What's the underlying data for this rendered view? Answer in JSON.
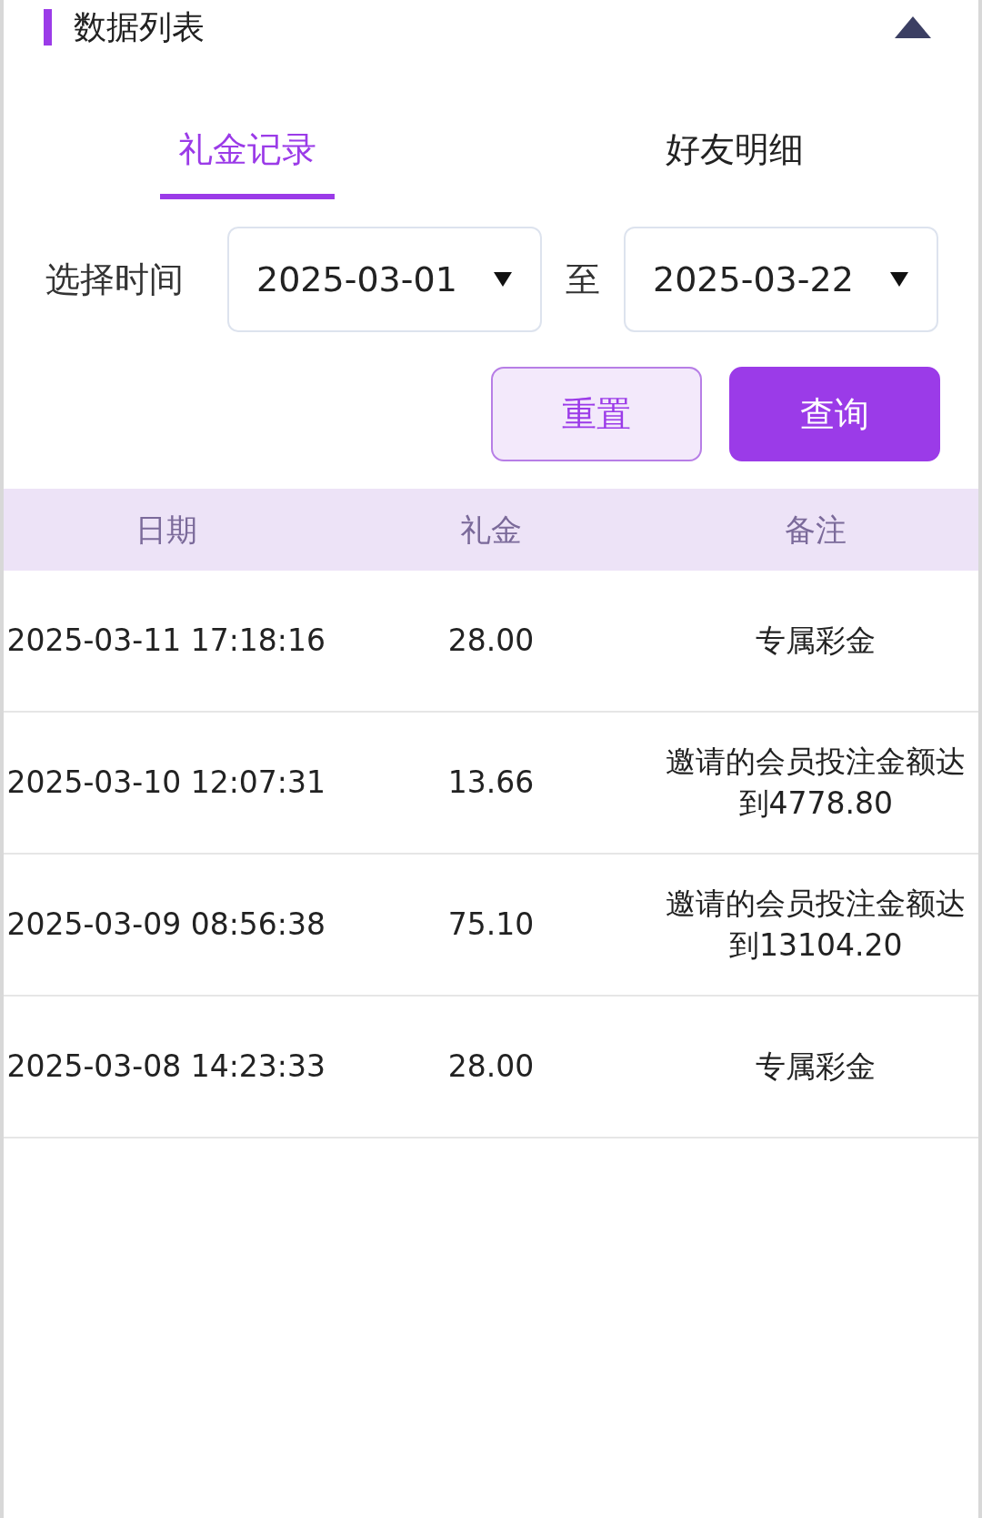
{
  "header": {
    "title": "数据列表",
    "expanded": true
  },
  "tabs": [
    {
      "label": "礼金记录",
      "selected": true
    },
    {
      "label": "好友明细",
      "selected": false
    }
  ],
  "filter": {
    "label": "选择时间",
    "start": "2025-03-01",
    "separator": "至",
    "end": "2025-03-22"
  },
  "buttons": [
    {
      "label": "重置",
      "kind": "secondary"
    },
    {
      "label": "查询",
      "kind": "primary"
    }
  ],
  "table": {
    "columns": [
      "日期",
      "礼金",
      "备注"
    ],
    "rows": [
      [
        "2025-03-11 17:18:16",
        "28.00",
        "专属彩金"
      ],
      [
        "2025-03-10 12:07:31",
        "13.66",
        "邀请的会员投注金额达到4778.80"
      ],
      [
        "2025-03-09 08:56:38",
        "75.10",
        "邀请的会员投注金额达到13104.20"
      ],
      [
        "2025-03-08 14:23:33",
        "28.00",
        "专属彩金"
      ]
    ]
  }
}
